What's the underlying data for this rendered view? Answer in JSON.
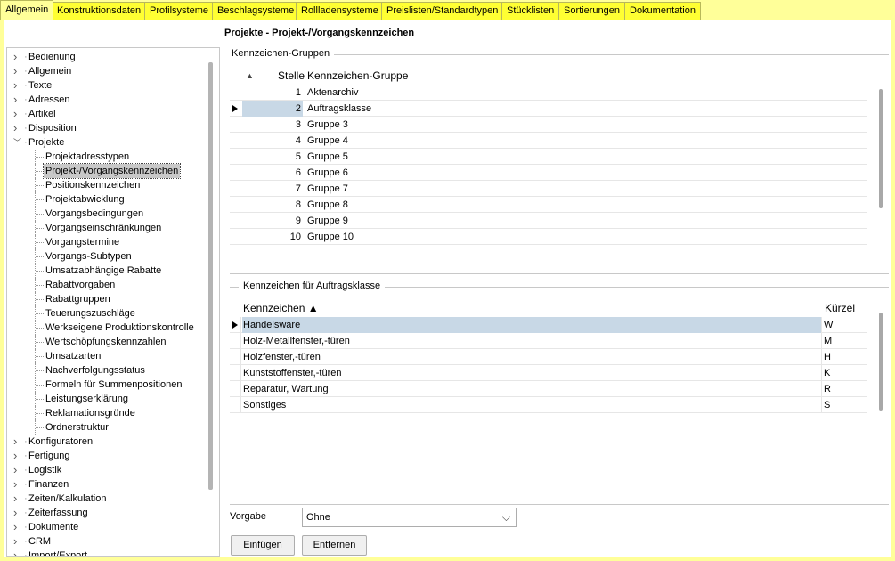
{
  "tabs": [
    {
      "label": "Allgemein",
      "active": true
    },
    {
      "label": "Konstruktionsdaten",
      "active": false
    },
    {
      "label": "Profilsysteme",
      "active": false
    },
    {
      "label": "Beschlagsysteme",
      "active": false
    },
    {
      "label": "Rollladensysteme",
      "active": false
    },
    {
      "label": "Preislisten/Standardtypen",
      "active": false
    },
    {
      "label": "Stücklisten",
      "active": false
    },
    {
      "label": "Sortierungen",
      "active": false
    },
    {
      "label": "Dokumentation",
      "active": false
    }
  ],
  "page_title": "Projekte - Projekt-/Vorgangskennzeichen",
  "tree": {
    "items": [
      {
        "label": "Bedienung",
        "level": 0,
        "expanded": false
      },
      {
        "label": "Allgemein",
        "level": 0,
        "expanded": false
      },
      {
        "label": "Texte",
        "level": 0,
        "expanded": false
      },
      {
        "label": "Adressen",
        "level": 0,
        "expanded": false
      },
      {
        "label": "Artikel",
        "level": 0,
        "expanded": false
      },
      {
        "label": "Disposition",
        "level": 0,
        "expanded": false
      },
      {
        "label": "Projekte",
        "level": 0,
        "expanded": true
      },
      {
        "label": "Projektadresstypen",
        "level": 1
      },
      {
        "label": "Projekt-/Vorgangskennzeichen",
        "level": 1,
        "selected": true
      },
      {
        "label": "Positionskennzeichen",
        "level": 1
      },
      {
        "label": "Projektabwicklung",
        "level": 1
      },
      {
        "label": "Vorgangsbedingungen",
        "level": 1
      },
      {
        "label": "Vorgangseinschränkungen",
        "level": 1
      },
      {
        "label": "Vorgangstermine",
        "level": 1
      },
      {
        "label": "Vorgangs-Subtypen",
        "level": 1
      },
      {
        "label": "Umsatzabhängige Rabatte",
        "level": 1
      },
      {
        "label": "Rabattvorgaben",
        "level": 1
      },
      {
        "label": "Rabattgruppen",
        "level": 1
      },
      {
        "label": "Teuerungszuschläge",
        "level": 1
      },
      {
        "label": "Werkseigene Produktionskontrolle",
        "level": 1
      },
      {
        "label": "Wertschöpfungskennzahlen",
        "level": 1
      },
      {
        "label": "Umsatzarten",
        "level": 1
      },
      {
        "label": "Nachverfolgungsstatus",
        "level": 1
      },
      {
        "label": "Formeln für Summenpositionen",
        "level": 1
      },
      {
        "label": "Leistungserklärung",
        "level": 1
      },
      {
        "label": "Reklamationsgründe",
        "level": 1
      },
      {
        "label": "Ordnerstruktur",
        "level": 1
      },
      {
        "label": "Konfiguratoren",
        "level": 0,
        "expanded": false
      },
      {
        "label": "Fertigung",
        "level": 0,
        "expanded": false
      },
      {
        "label": "Logistik",
        "level": 0,
        "expanded": false
      },
      {
        "label": "Finanzen",
        "level": 0,
        "expanded": false
      },
      {
        "label": "Zeiten/Kalkulation",
        "level": 0,
        "expanded": false
      },
      {
        "label": "Zeiterfassung",
        "level": 0,
        "expanded": false
      },
      {
        "label": "Dokumente",
        "level": 0,
        "expanded": false
      },
      {
        "label": "CRM",
        "level": 0,
        "expanded": false
      },
      {
        "label": "Import/Export",
        "level": 0,
        "expanded": false
      }
    ]
  },
  "groups_box": {
    "title": "Kennzeichen-Gruppen",
    "sort_icon": "▲",
    "columns": [
      "Stelle",
      "Kennzeichen-Gruppe"
    ],
    "rows": [
      {
        "stelle": "1",
        "gruppe": "Aktenarchiv",
        "selected": false
      },
      {
        "stelle": "2",
        "gruppe": "Auftragsklasse",
        "selected": true
      },
      {
        "stelle": "3",
        "gruppe": "Gruppe 3",
        "selected": false
      },
      {
        "stelle": "4",
        "gruppe": "Gruppe 4",
        "selected": false
      },
      {
        "stelle": "5",
        "gruppe": "Gruppe 5",
        "selected": false
      },
      {
        "stelle": "6",
        "gruppe": "Gruppe 6",
        "selected": false
      },
      {
        "stelle": "7",
        "gruppe": "Gruppe 7",
        "selected": false
      },
      {
        "stelle": "8",
        "gruppe": "Gruppe 8",
        "selected": false
      },
      {
        "stelle": "9",
        "gruppe": "Gruppe 9",
        "selected": false
      },
      {
        "stelle": "10",
        "gruppe": "Gruppe 10",
        "selected": false
      }
    ]
  },
  "codes_box": {
    "title": "Kennzeichen für Auftragsklasse",
    "columns": [
      "Kennzeichen ▲",
      "Kürzel"
    ],
    "rows": [
      {
        "kennzeichen": "Handelsware",
        "kuerzel": "W",
        "selected": true
      },
      {
        "kennzeichen": "Holz-Metallfenster,-türen",
        "kuerzel": "M",
        "selected": false
      },
      {
        "kennzeichen": "Holzfenster,-türen",
        "kuerzel": "H",
        "selected": false
      },
      {
        "kennzeichen": "Kunststoffenster,-türen",
        "kuerzel": "K",
        "selected": false
      },
      {
        "kennzeichen": "Reparatur, Wartung",
        "kuerzel": "R",
        "selected": false
      },
      {
        "kennzeichen": "Sonstiges",
        "kuerzel": "S",
        "selected": false
      }
    ]
  },
  "vorgabe": {
    "label": "Vorgabe",
    "value": "Ohne"
  },
  "buttons": {
    "insert": "Einfügen",
    "remove": "Entfernen"
  },
  "colors": {
    "background": "#ffff99",
    "tab": "#ffff33",
    "selection": "#c8d8e6"
  }
}
